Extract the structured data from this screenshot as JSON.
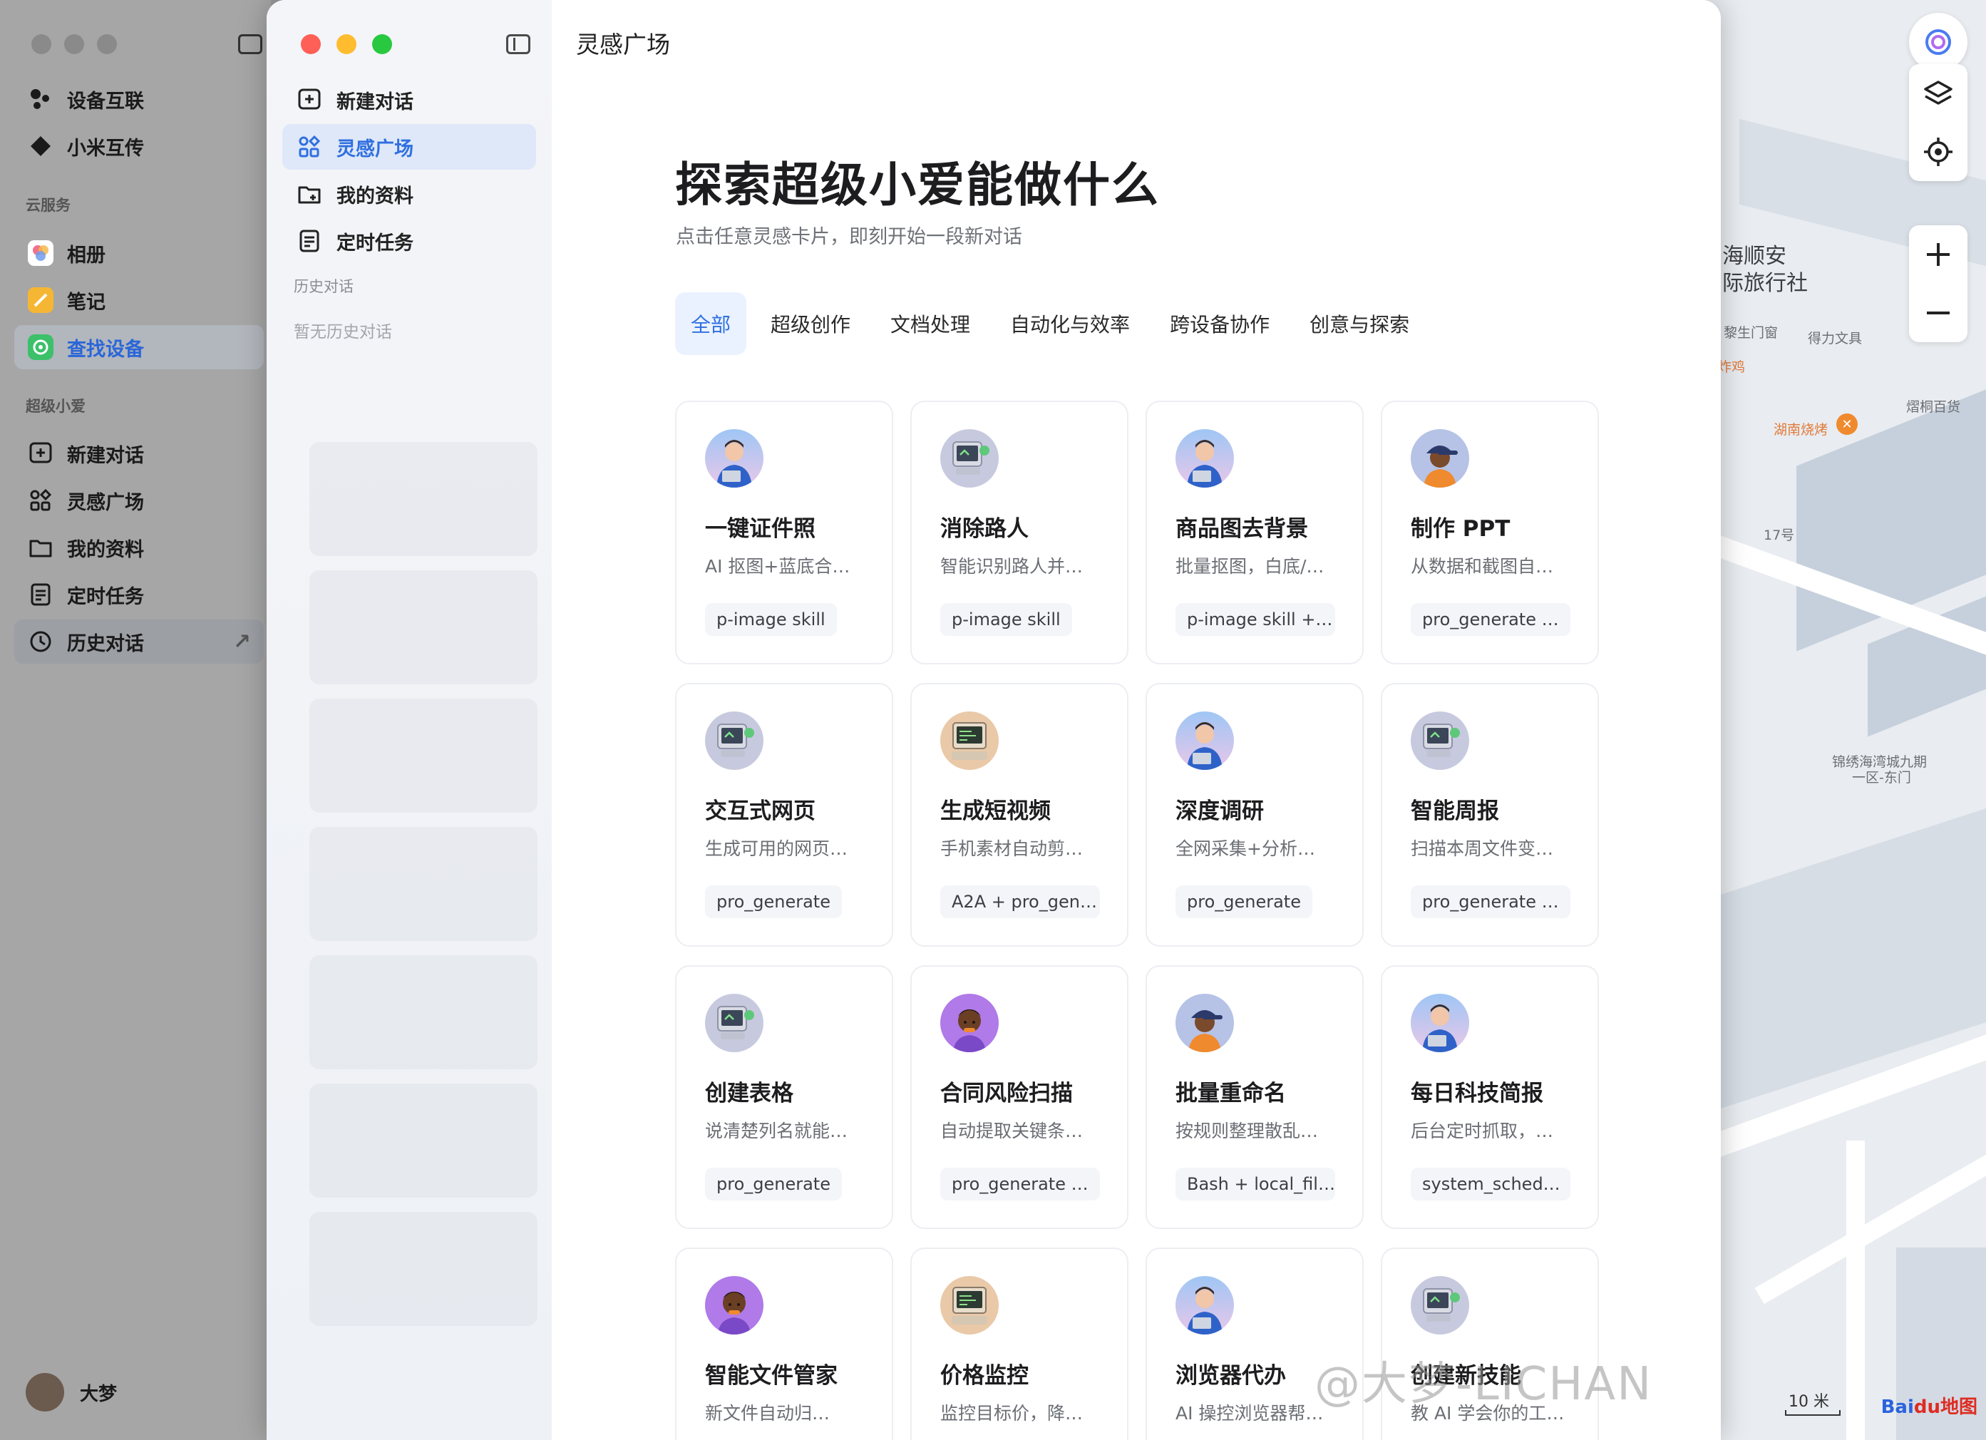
{
  "window_title": "灵感广场",
  "bg_sidebar": {
    "items": [
      {
        "label": "设备互联"
      },
      {
        "label": "小米互传"
      },
      {
        "label": "相册"
      },
      {
        "label": "笔记"
      },
      {
        "label": "查找设备"
      },
      {
        "label": "新建对话"
      },
      {
        "label": "灵感广场"
      },
      {
        "label": "我的资料"
      },
      {
        "label": "定时任务"
      },
      {
        "label": "历史对话"
      }
    ],
    "section_cloud": "云服务",
    "section_ai": "超级小爱",
    "user_name": "大梦"
  },
  "sidebar": {
    "items": [
      {
        "label": "新建对话",
        "icon": "new-chat-icon"
      },
      {
        "label": "灵感广场",
        "icon": "inspiration-icon"
      },
      {
        "label": "我的资料",
        "icon": "my-data-icon"
      },
      {
        "label": "定时任务",
        "icon": "scheduled-task-icon"
      }
    ],
    "history_label": "历史对话",
    "history_empty": "暂无历史对话"
  },
  "hero": {
    "title": "探索超级小爱能做什么",
    "subtitle": "点击任意灵感卡片，即刻开始一段新对话"
  },
  "tabs": [
    {
      "label": "全部",
      "active": true
    },
    {
      "label": "超级创作"
    },
    {
      "label": "文档处理"
    },
    {
      "label": "自动化与效率"
    },
    {
      "label": "跨设备协作"
    },
    {
      "label": "创意与探索"
    }
  ],
  "cards": [
    {
      "title": "一键证件照",
      "desc": "AI 抠图+蓝底合…",
      "tag": "p-image skill",
      "avatar": "person"
    },
    {
      "title": "消除路人",
      "desc": "智能识别路人并…",
      "tag": "p-image skill",
      "avatar": "computer"
    },
    {
      "title": "商品图去背景",
      "desc": "批量抠图，白底/…",
      "tag": "p-image skill +…",
      "avatar": "person"
    },
    {
      "title": "制作 PPT",
      "desc": "从数据和截图自…",
      "tag": "pro_generate …",
      "avatar": "cap"
    },
    {
      "title": "交互式网页",
      "desc": "生成可用的网页…",
      "tag": "pro_generate",
      "avatar": "computer"
    },
    {
      "title": "生成短视频",
      "desc": "手机素材自动剪…",
      "tag": "A2A + pro_gen…",
      "avatar": "retro"
    },
    {
      "title": "深度调研",
      "desc": "全网采集+分析…",
      "tag": "pro_generate",
      "avatar": "person"
    },
    {
      "title": "智能周报",
      "desc": "扫描本周文件变…",
      "tag": "pro_generate …",
      "avatar": "computer"
    },
    {
      "title": "创建表格",
      "desc": "说清楚列名就能…",
      "tag": "pro_generate",
      "avatar": "computer"
    },
    {
      "title": "合同风险扫描",
      "desc": "自动提取关键条…",
      "tag": "pro_generate …",
      "avatar": "purple"
    },
    {
      "title": "批量重命名",
      "desc": "按规则整理散乱…",
      "tag": "Bash + local_fil…",
      "avatar": "cap"
    },
    {
      "title": "每日科技简报",
      "desc": "后台定时抓取，…",
      "tag": "system_sched…",
      "avatar": "person"
    },
    {
      "title": "智能文件管家",
      "desc": "新文件自动归…",
      "tag": "",
      "avatar": "purple"
    },
    {
      "title": "价格监控",
      "desc": "监控目标价，降…",
      "tag": "",
      "avatar": "retro"
    },
    {
      "title": "浏览器代办",
      "desc": "AI 操控浏览器帮…",
      "tag": "",
      "avatar": "person"
    },
    {
      "title": "创建新技能",
      "desc": "教 AI 学会你的工…",
      "tag": "",
      "avatar": "computer"
    }
  ],
  "map": {
    "labels": [
      "海顺安",
      "际旅行社",
      "黎生门窗",
      "得力文具",
      "炸鸡",
      "湖南烧烤",
      "熠桐百货",
      "17号",
      "锦绣海湾城九期",
      "一区-东门"
    ],
    "scale": "10 米",
    "logo_a": "Bai",
    "logo_b": "du地图"
  },
  "watermark": "@大梦-LICHAN"
}
